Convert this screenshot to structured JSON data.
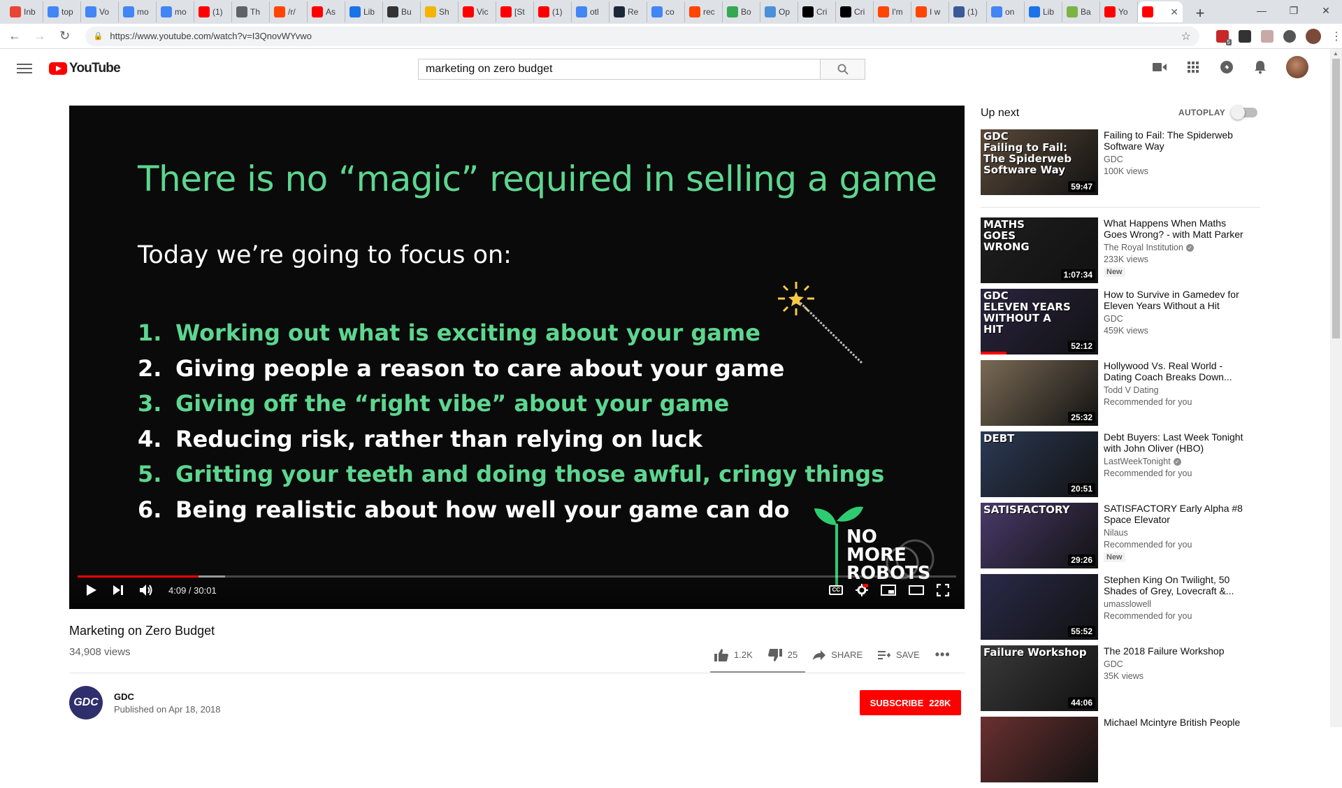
{
  "browser": {
    "tabs": [
      {
        "label": "Inb",
        "icon": "gmail-icon",
        "color": "#ea4335"
      },
      {
        "label": "top",
        "icon": "google-icon",
        "color": "#4285f4"
      },
      {
        "label": "Vo",
        "icon": "google-icon",
        "color": "#4285f4"
      },
      {
        "label": "mo",
        "icon": "google-icon",
        "color": "#4285f4"
      },
      {
        "label": "mo",
        "icon": "google-icon",
        "color": "#4285f4"
      },
      {
        "label": "(1)",
        "icon": "youtube-icon",
        "color": "#ff0000"
      },
      {
        "label": "Th",
        "icon": "page-icon",
        "color": "#5f6368"
      },
      {
        "label": "/r/",
        "icon": "reddit-icon",
        "color": "#ff4500"
      },
      {
        "label": "As",
        "icon": "youtube-icon",
        "color": "#ff0000"
      },
      {
        "label": "Lib",
        "icon": "link-icon",
        "color": "#1a73e8"
      },
      {
        "label": "Bu",
        "icon": "page-icon",
        "color": "#333333"
      },
      {
        "label": "Sh",
        "icon": "star-icon",
        "color": "#f4b400"
      },
      {
        "label": "Vic",
        "icon": "youtube-icon",
        "color": "#ff0000"
      },
      {
        "label": "[St",
        "icon": "youtube-icon",
        "color": "#ff0000"
      },
      {
        "label": "(1)",
        "icon": "youtube-icon",
        "color": "#ff0000"
      },
      {
        "label": "otl",
        "icon": "google-icon",
        "color": "#4285f4"
      },
      {
        "label": "Re",
        "icon": "steam-icon",
        "color": "#1b2838"
      },
      {
        "label": "co",
        "icon": "google-icon",
        "color": "#4285f4"
      },
      {
        "label": "rec",
        "icon": "reddit-icon",
        "color": "#ff4500"
      },
      {
        "label": "Bo",
        "icon": "leaf-icon",
        "color": "#34a853"
      },
      {
        "label": "Op",
        "icon": "page-icon",
        "color": "#4a90d9"
      },
      {
        "label": "Cri",
        "icon": "cc-icon",
        "color": "#000000"
      },
      {
        "label": "Cri",
        "icon": "cc-icon",
        "color": "#000000"
      },
      {
        "label": "I'm",
        "icon": "reddit-icon",
        "color": "#ff4500"
      },
      {
        "label": "I w",
        "icon": "reddit-icon",
        "color": "#ff4500"
      },
      {
        "label": "(1)",
        "icon": "facebook-icon",
        "color": "#3b5998"
      },
      {
        "label": "on",
        "icon": "google-icon",
        "color": "#4285f4"
      },
      {
        "label": "Lib",
        "icon": "link-icon",
        "color": "#1a73e8"
      },
      {
        "label": "Ba",
        "icon": "page-icon",
        "color": "#7cb342"
      },
      {
        "label": "Yo",
        "icon": "youtube-icon",
        "color": "#ff0000"
      },
      {
        "label": "",
        "icon": "youtube-icon",
        "color": "#ff0000",
        "active": true
      }
    ],
    "url": "https://www.youtube.com/watch?v=I3QnovWYvwo",
    "ext_badge": "5"
  },
  "youtube": {
    "logo_text": "YouTube",
    "search_query": "marketing on zero budget"
  },
  "slide": {
    "title": "There is no “magic” required in selling a game",
    "subtitle": "Today we’re going to focus on:",
    "items": [
      {
        "num": "1.",
        "text": "Working out what is exciting about your game",
        "green": true
      },
      {
        "num": "2.",
        "text": "Giving people a reason to care about your game",
        "green": false
      },
      {
        "num": "3.",
        "text": "Giving off the “right vibe” about your game",
        "green": true
      },
      {
        "num": "4.",
        "text": "Reducing risk, rather than relying on luck",
        "green": false
      },
      {
        "num": "5.",
        "text": "Gritting your teeth and doing those awful, cringy things",
        "green": true
      },
      {
        "num": "6.",
        "text": "Being realistic about how well your game can do",
        "green": false
      }
    ],
    "logo_lines": [
      "NO",
      "MORE",
      "ROBOTS"
    ]
  },
  "player": {
    "time": "4:09 / 30:01",
    "played_fraction": 0.138,
    "buffered_fraction": 0.168
  },
  "video": {
    "title": "Marketing on Zero Budget",
    "views": "34,908 views",
    "likes": "1.2K",
    "dislikes": "25",
    "share_label": "SHARE",
    "save_label": "SAVE",
    "channel": "GDC",
    "channel_avatar": "GDC",
    "published": "Published on Apr 18, 2018",
    "subscribe_label": "SUBSCRIBE",
    "subscriber_count": "228K"
  },
  "sidebar": {
    "up_next": "Up next",
    "autoplay": "AUTOPLAY",
    "items": [
      {
        "title": "Failing to Fail: The Spiderweb Software Way",
        "channel": "GDC",
        "verified": false,
        "meta": "100K views",
        "duration": "59:47",
        "thumb_text": "GDC\nFailing to Fail:\nThe Spiderweb\nSoftware Way",
        "thumb_bg": "#5b4a3a",
        "new": false
      },
      {
        "title": "What Happens When Maths Goes Wrong? - with Matt Parker",
        "channel": "The Royal Institution",
        "verified": true,
        "meta": "233K views",
        "duration": "1:07:34",
        "thumb_text": "MATHS\nGOES\nWRONG",
        "thumb_bg": "#1e1e1e",
        "new": true
      },
      {
        "title": "How to Survive in Gamedev for Eleven Years Without a Hit",
        "channel": "GDC",
        "verified": false,
        "meta": "459K views",
        "duration": "52:12",
        "thumb_text": "GDC\nELEVEN YEARS\nWITHOUT A\nHIT",
        "thumb_bg": "#2a2440",
        "new": false,
        "watched": 0.22
      },
      {
        "title": "Hollywood Vs. Real World - Dating Coach Breaks Down...",
        "channel": "Todd V Dating",
        "verified": false,
        "meta": "Recommended for you",
        "duration": "25:32",
        "thumb_text": "",
        "thumb_bg": "#7a6a55",
        "new": false
      },
      {
        "title": "Debt Buyers: Last Week Tonight with John Oliver (HBO)",
        "channel": "LastWeekTonight",
        "verified": true,
        "meta": "Recommended for you",
        "duration": "20:51",
        "thumb_text": "DEBT",
        "thumb_bg": "#2c3a55",
        "new": false
      },
      {
        "title": "SATISFACTORY Early Alpha #8 Space Elevator",
        "channel": "Nilaus",
        "verified": false,
        "meta": "Recommended for you",
        "duration": "29:26",
        "thumb_text": "SATISFACTORY",
        "thumb_bg": "#4a3a6a",
        "new": true
      },
      {
        "title": "Stephen King On Twilight, 50 Shades of Grey, Lovecraft &...",
        "channel": "umasslowell",
        "verified": false,
        "meta": "Recommended for you",
        "duration": "55:52",
        "thumb_text": "",
        "thumb_bg": "#2a2a4a",
        "new": false
      },
      {
        "title": "The 2018 Failure Workshop",
        "channel": "GDC",
        "verified": false,
        "meta": "35K views",
        "duration": "44:06",
        "thumb_text": "Failure Workshop",
        "thumb_bg": "#3a3a3a",
        "new": false
      },
      {
        "title": "Michael Mcintyre British People",
        "channel": "",
        "verified": false,
        "meta": "",
        "duration": "",
        "thumb_text": "",
        "thumb_bg": "#6a3030",
        "new": false
      }
    ]
  }
}
